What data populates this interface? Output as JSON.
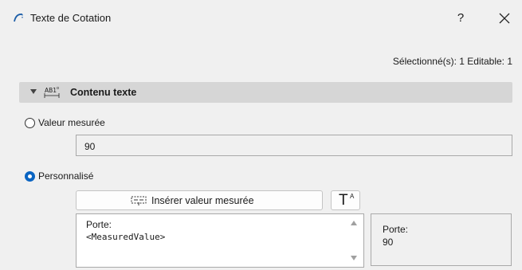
{
  "window": {
    "title": "Texte de Cotation",
    "help_label": "?",
    "close_label": "close"
  },
  "selection_info": "Sélectionné(s): 1 Editable: 1",
  "section": {
    "title": "Contenu texte",
    "icon": "dimension-text-icon"
  },
  "options": {
    "measured": {
      "label": "Valeur mesurée",
      "checked": false,
      "value": "90"
    },
    "custom": {
      "label": "Personnalisé",
      "checked": true
    }
  },
  "toolbar": {
    "insert_label": "Insérer valeur mesurée",
    "font_glyph": "T",
    "font_sup": "A"
  },
  "editor": {
    "line1": "Porte:",
    "line2": "<MeasuredValue>"
  },
  "preview": {
    "line1": "Porte:",
    "line2": "90"
  },
  "colors": {
    "accent": "#0a64c2",
    "background": "#f0f0f0",
    "section_header": "#d6d6d6"
  }
}
